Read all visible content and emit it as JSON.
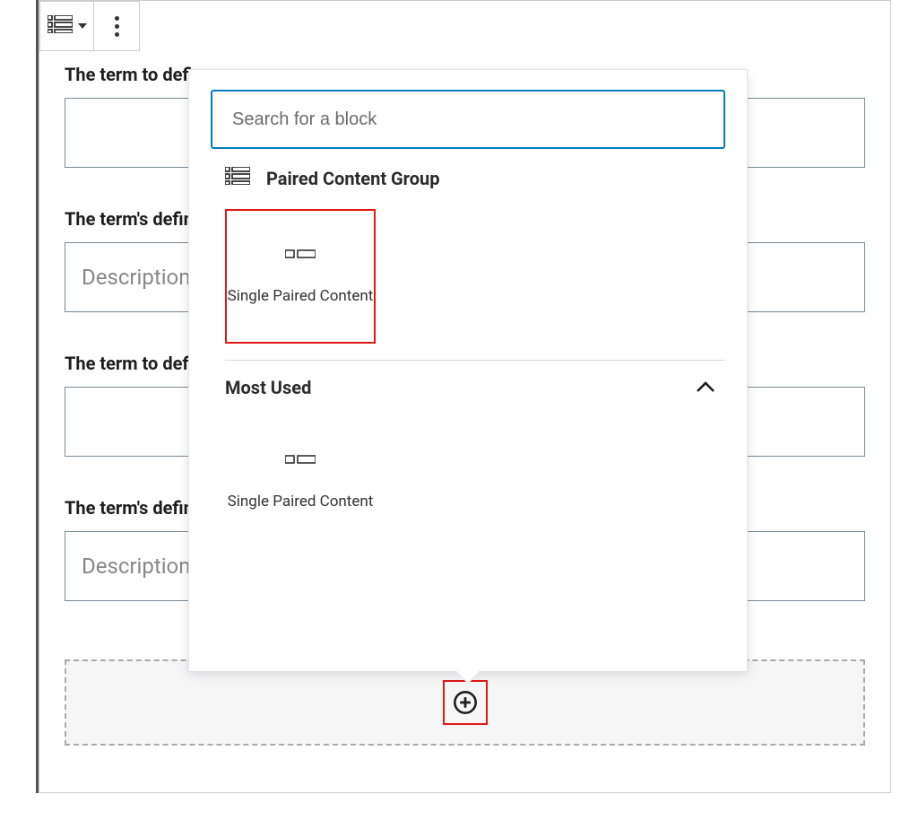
{
  "fields": [
    {
      "label": "The term to define",
      "placeholder": ""
    },
    {
      "label": "The term's definition",
      "placeholder": "Description"
    },
    {
      "label": "The term to define",
      "placeholder": ""
    },
    {
      "label": "The term's definition",
      "placeholder": "Description"
    }
  ],
  "popover": {
    "search_placeholder": "Search for a block",
    "group_label": "Paired Content Group",
    "block_label": "Single Paired Content",
    "most_used_label": "Most Used",
    "most_used_block_label": "Single Paired Content"
  }
}
